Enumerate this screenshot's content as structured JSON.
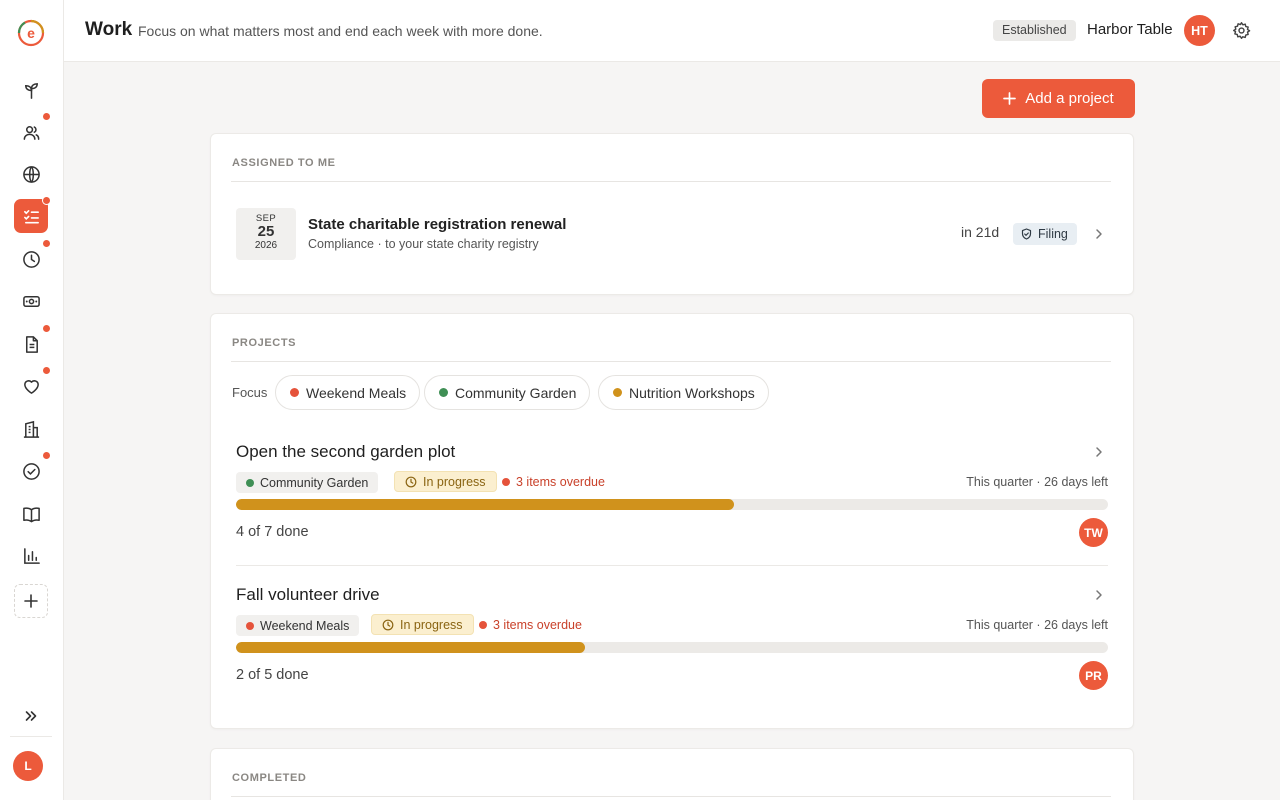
{
  "header": {
    "title": "Work",
    "subtitle": "Focus on what matters most and end each week with more done.",
    "tier_badge": "Established",
    "org_name": "Harbor Table",
    "org_initials": "HT"
  },
  "sidebar": {
    "user_initial": "L",
    "items": [
      {
        "icon": "sprout-icon",
        "notify": false
      },
      {
        "icon": "people-icon",
        "notify": true
      },
      {
        "icon": "globe-icon",
        "notify": false
      },
      {
        "icon": "checklist-icon",
        "notify": true,
        "active": true
      },
      {
        "icon": "clock-icon",
        "notify": true
      },
      {
        "icon": "cash-icon",
        "notify": false
      },
      {
        "icon": "document-icon",
        "notify": true
      },
      {
        "icon": "heart-icon",
        "notify": true
      },
      {
        "icon": "building-icon",
        "notify": false
      },
      {
        "icon": "check-circle-icon",
        "notify": true
      },
      {
        "icon": "book-icon",
        "notify": false
      },
      {
        "icon": "bar-chart-icon",
        "notify": false
      }
    ]
  },
  "actions": {
    "add_project": "Add a project"
  },
  "assigned": {
    "label": "ASSIGNED TO ME",
    "task": {
      "month": "SEP",
      "day": "25",
      "year": "2026",
      "title": "State charitable registration renewal",
      "subtitle": "Compliance · to your state charity registry",
      "due": "in 21d",
      "badge": "Filing"
    }
  },
  "projects": {
    "label": "PROJECTS",
    "focus_label": "Focus",
    "focus_chips": [
      {
        "label": "Weekend Meals",
        "color": "#e5533b"
      },
      {
        "label": "Community Garden",
        "color": "#3f8f55"
      },
      {
        "label": "Nutrition Workshops",
        "color": "#d0921c"
      }
    ],
    "items": [
      {
        "title": "Open the second garden plot",
        "area": "Community Garden",
        "area_color": "#3f8f55",
        "status": "In progress",
        "overdue": "3 items overdue",
        "timeframe": "This quarter · 26 days left",
        "progress": 0.571,
        "done": "4 of 7 done",
        "owner": "TW"
      },
      {
        "title": "Fall volunteer drive",
        "area": "Weekend Meals",
        "area_color": "#e5533b",
        "status": "In progress",
        "overdue": "3 items overdue",
        "timeframe": "This quarter · 26 days left",
        "progress": 0.4,
        "done": "2 of 5 done",
        "owner": "PR"
      }
    ]
  },
  "completed": {
    "label": "COMPLETED"
  },
  "colors": {
    "accent": "#ec5a3b",
    "progress": "#d0921c",
    "overdue": "#c9412a"
  }
}
